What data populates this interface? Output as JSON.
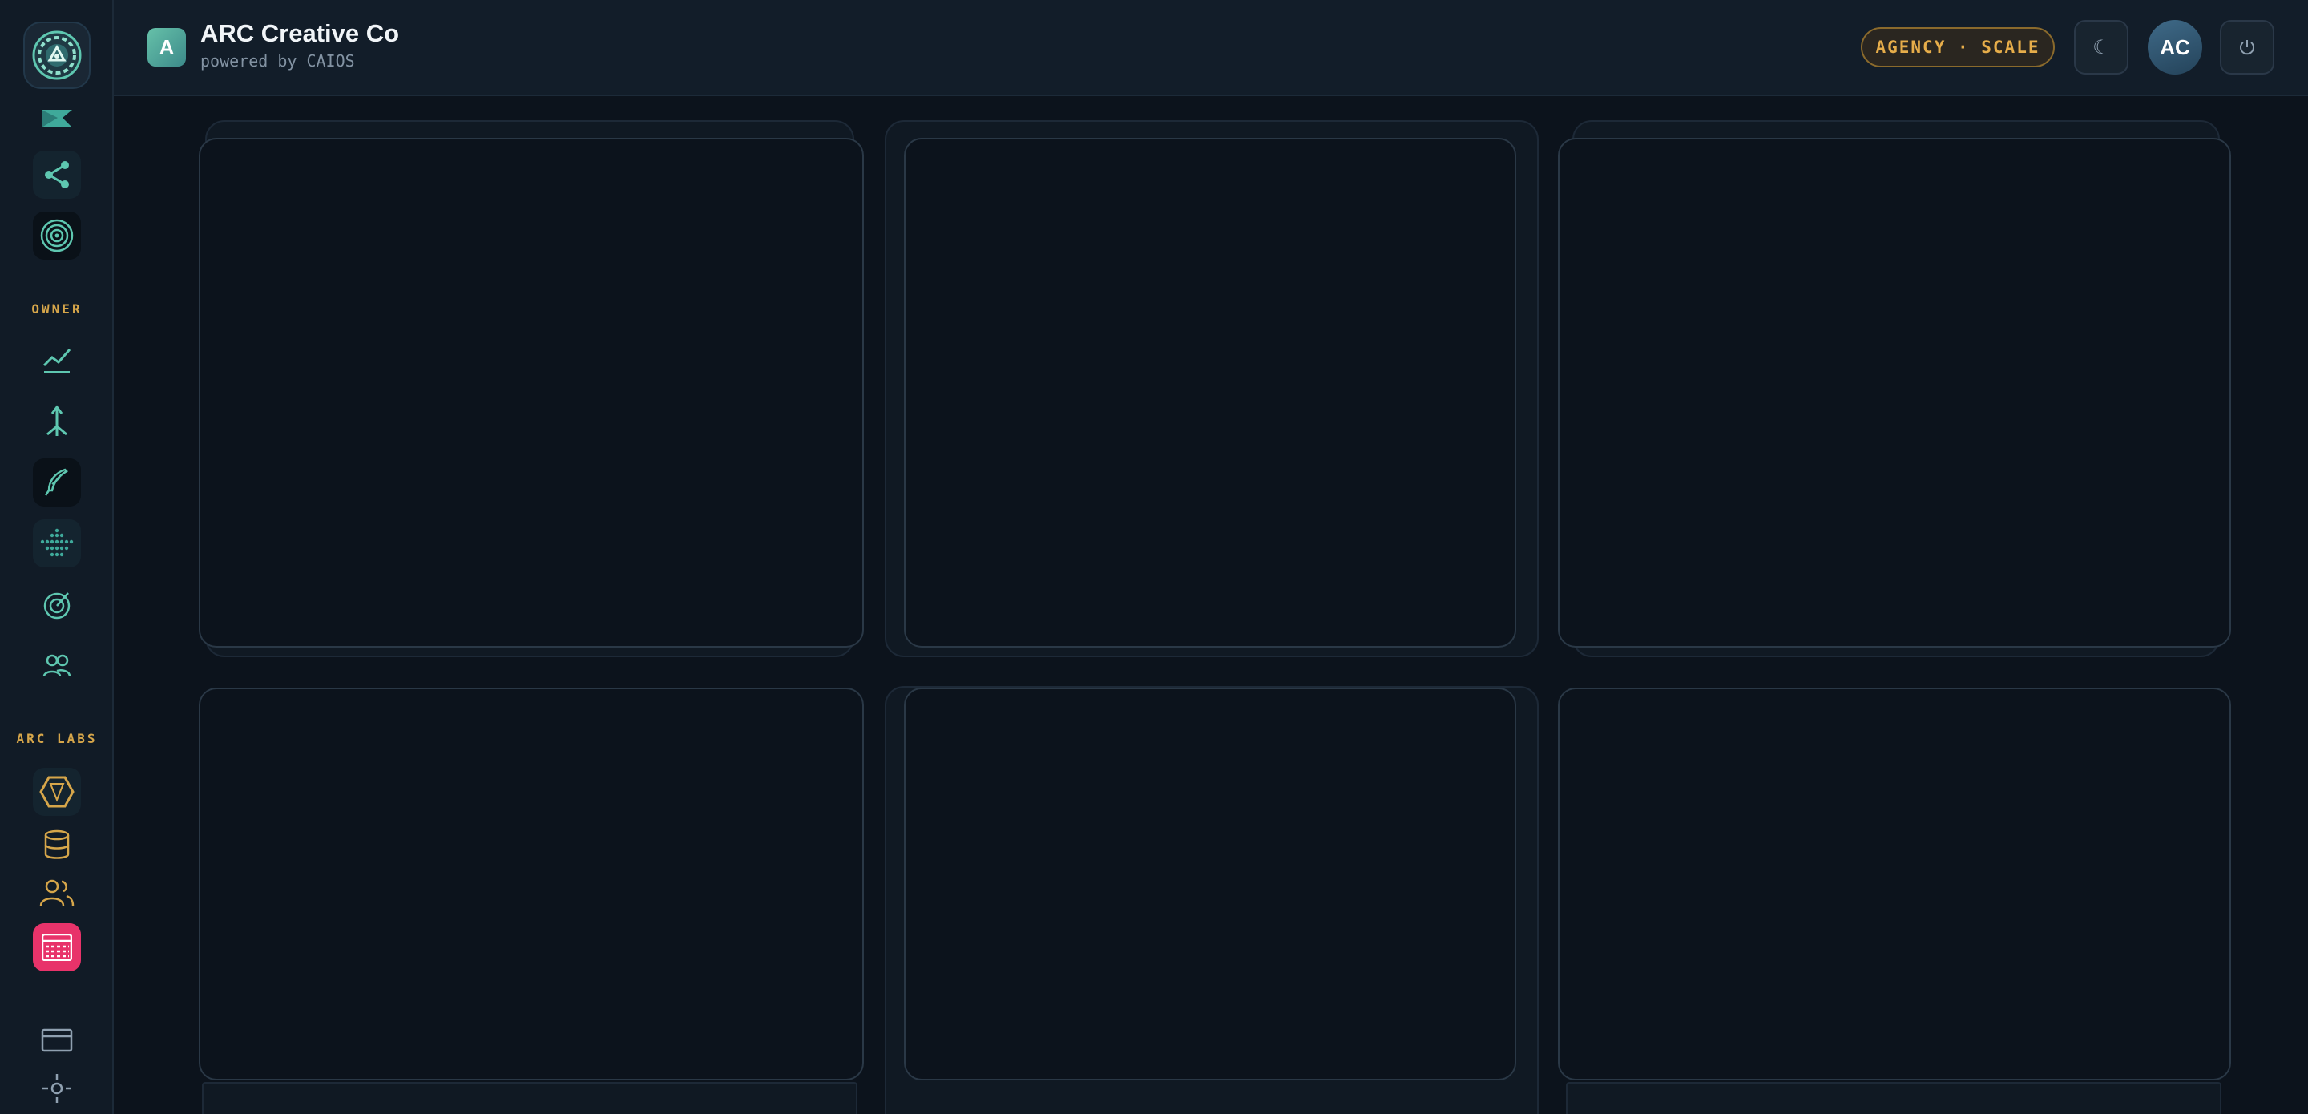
{
  "header": {
    "brand_initial": "A",
    "company_name": "ARC Creative Co",
    "powered_by": "powered by CAIOS",
    "plan_badge": "AGENCY · SCALE",
    "avatar_initials": "AC"
  },
  "sidebar": {
    "section_owner": "OWNER",
    "section_labs": "ARC LABS"
  },
  "colors": {
    "teal_accent": "#5ec7b0",
    "gold_accent": "#d6a64a",
    "pink_accent": "#e8336a",
    "background": "#0c131c"
  },
  "icons": {
    "sidebar": [
      "brand-ring-icon",
      "flag-icon",
      "share-nodes-icon",
      "target-rings-icon",
      "trend-line-icon",
      "split-arrows-icon",
      "quill-icon",
      "dot-grid-icon",
      "radar-icon",
      "users-icon",
      "hexagon-icon",
      "database-icon",
      "team-icon",
      "calendar-grid-icon",
      "card-icon",
      "settings-sun-icon"
    ],
    "header": [
      "moon-icon",
      "power-icon"
    ]
  }
}
